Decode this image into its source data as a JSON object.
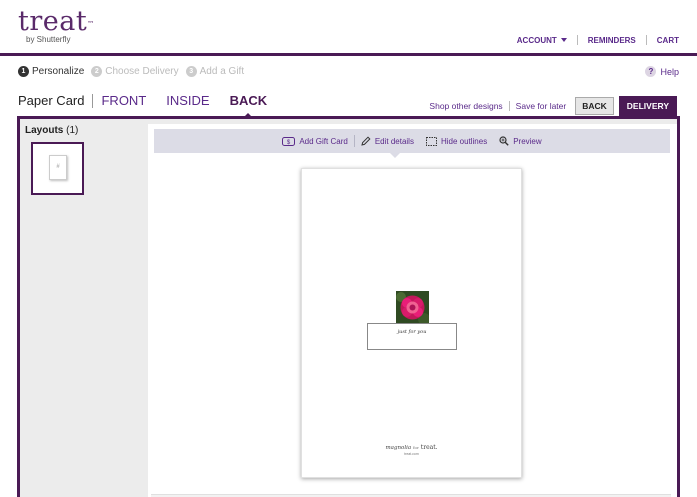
{
  "logo": {
    "word": "treat",
    "tm": "™",
    "sub": "by Shutterfly"
  },
  "topnav": {
    "account": "ACCOUNT",
    "reminders": "REMINDERS",
    "cart": "CART"
  },
  "steps": [
    {
      "num": "1",
      "label": "Personalize"
    },
    {
      "num": "2",
      "label": "Choose Delivery"
    },
    {
      "num": "3",
      "label": "Add a Gift"
    }
  ],
  "help": {
    "icon": "?",
    "label": "Help"
  },
  "tabs": {
    "card_type": "Paper Card",
    "front": "FRONT",
    "inside": "INSIDE",
    "back": "BACK"
  },
  "actions": {
    "shop": "Shop other designs",
    "save": "Save for later",
    "back": "BACK",
    "delivery": "DELIVERY"
  },
  "layouts": {
    "title": "Layouts",
    "count": "(1)",
    "thumb_glyph": "#"
  },
  "toolbar": {
    "add_gift_card": "Add Gift Card",
    "edit_details": "Edit details",
    "hide_outlines": "Hide outlines",
    "preview": "Preview"
  },
  "card": {
    "text": "just for you",
    "brand_left": "magnolia",
    "brand_mid": "for",
    "brand_right": "treat.",
    "url": "treat.com"
  },
  "colors": {
    "brand_purple": "#4a1a55",
    "link_purple": "#5a2a8a",
    "toolbar_bg": "#dcdce6"
  }
}
